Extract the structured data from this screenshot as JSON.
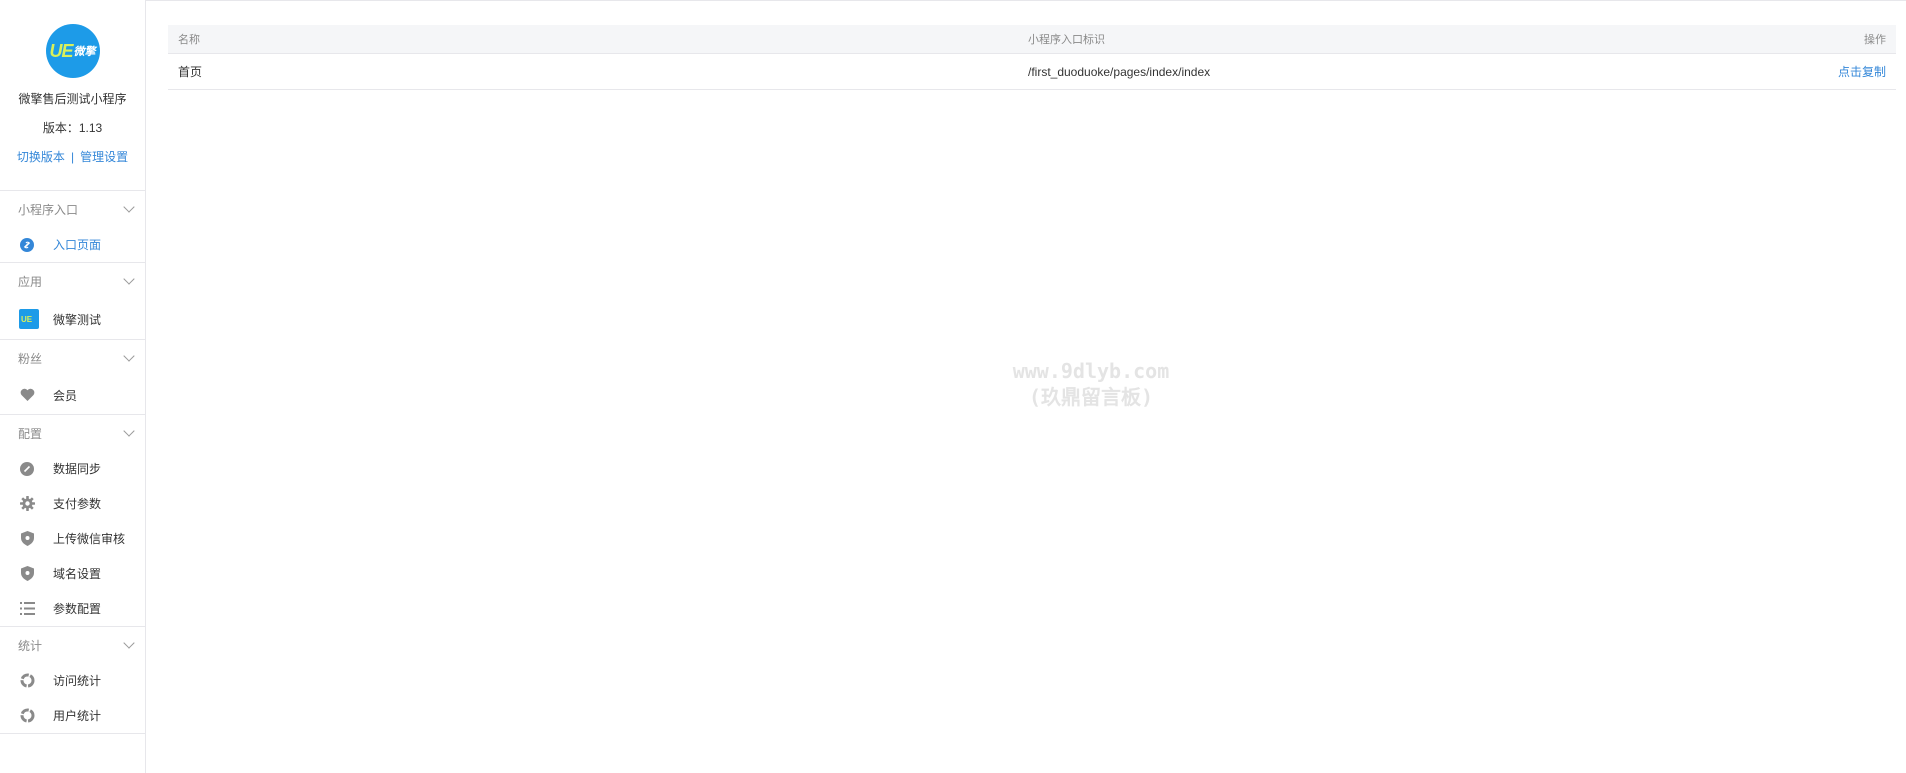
{
  "sidebar": {
    "app_name": "微擎售后测试小程序",
    "version": "版本：1.13",
    "switch_version": "切换版本",
    "separator": "|",
    "manage_settings": "管理设置",
    "logo_text_main": "UE",
    "logo_text_sub": "微擎",
    "groups": [
      {
        "title": "小程序入口",
        "items": [
          {
            "label": "入口页面",
            "icon": "link-icon",
            "active": true
          }
        ]
      },
      {
        "title": "应用",
        "items": [
          {
            "label": "微擎测试",
            "icon": "app-logo-icon"
          }
        ]
      },
      {
        "title": "粉丝",
        "items": [
          {
            "label": "会员",
            "icon": "heart-icon"
          }
        ]
      },
      {
        "title": "配置",
        "items": [
          {
            "label": "数据同步",
            "icon": "sync-icon"
          },
          {
            "label": "支付参数",
            "icon": "gear-icon"
          },
          {
            "label": "上传微信审核",
            "icon": "shield-icon"
          },
          {
            "label": "域名设置",
            "icon": "shield-icon"
          },
          {
            "label": "参数配置",
            "icon": "list-icon"
          }
        ]
      },
      {
        "title": "统计",
        "items": [
          {
            "label": "访问统计",
            "icon": "ring-chart-icon"
          },
          {
            "label": "用户统计",
            "icon": "ring-chart-icon"
          }
        ]
      }
    ]
  },
  "table": {
    "headers": [
      "名称",
      "小程序入口标识",
      "操作"
    ],
    "rows": [
      {
        "name": "首页",
        "path": "/first_duoduoke/pages/index/index",
        "action": "点击复制"
      }
    ]
  },
  "watermark": {
    "line1": "www.9dlyb.com",
    "line2": "(玖鼎留言板)"
  },
  "colors": {
    "accent": "#3487d8",
    "border": "#e7e7eb",
    "header_bg": "#f5f6f8",
    "logo_bg": "#1d9be8"
  }
}
